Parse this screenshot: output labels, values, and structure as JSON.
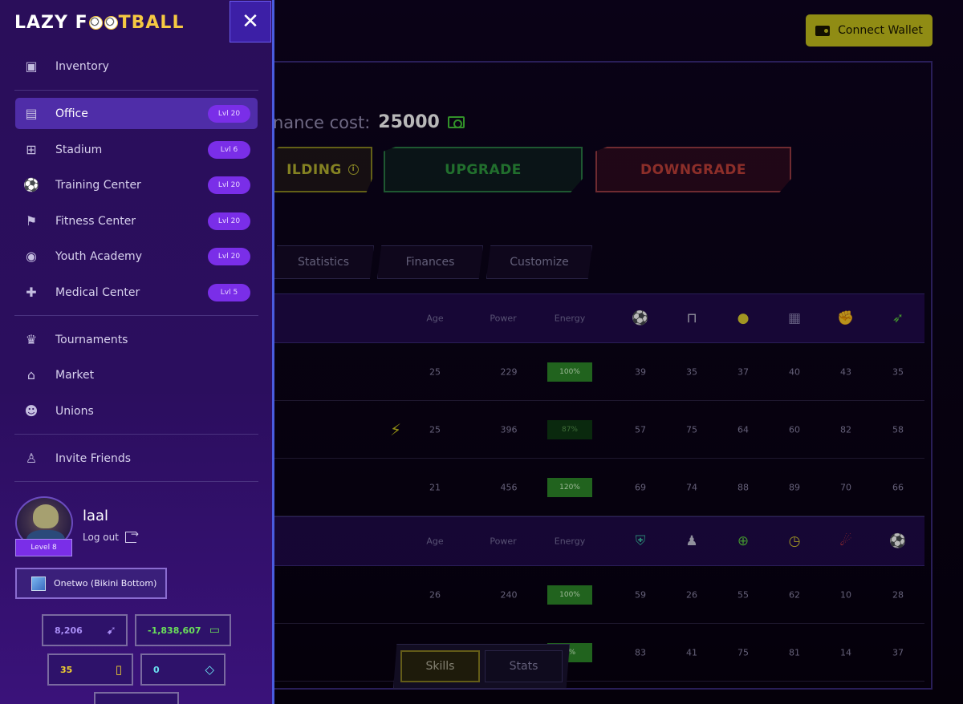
{
  "header": {
    "connect_wallet_label": "Connect Wallet"
  },
  "building": {
    "maintenance_label": "nance cost:",
    "maintenance_value": "25000",
    "actions": {
      "building_label": "ILDING",
      "upgrade_label": "UPGRADE",
      "downgrade_label": "DOWNGRADE"
    }
  },
  "tabs": [
    "Statistics",
    "Finances",
    "Customize"
  ],
  "table": {
    "headers": {
      "age": "Age",
      "power": "Power",
      "energy": "Energy"
    },
    "section1_rows": [
      {
        "age": "25",
        "power": "229",
        "energy": "100%",
        "stats": [
          "39",
          "35",
          "37",
          "40",
          "43",
          "35"
        ]
      },
      {
        "age": "25",
        "power": "396",
        "energy": "87%",
        "stats": [
          "57",
          "75",
          "64",
          "60",
          "82",
          "58"
        ]
      },
      {
        "age": "21",
        "power": "456",
        "energy": "120%",
        "stats": [
          "69",
          "74",
          "88",
          "89",
          "70",
          "66"
        ]
      }
    ],
    "section2_rows": [
      {
        "age": "26",
        "power": "240",
        "energy": "100%",
        "stats": [
          "59",
          "26",
          "55",
          "62",
          "10",
          "28"
        ]
      },
      {
        "age": "",
        "power": "",
        "energy": "0%",
        "stats": [
          "83",
          "41",
          "75",
          "81",
          "14",
          "37"
        ]
      }
    ]
  },
  "bottom_toggle": {
    "skills_label": "Skills",
    "stats_label": "Stats"
  },
  "sidebar": {
    "logo": {
      "part1": "LAZY F",
      "part2": "TBALL"
    },
    "nav": [
      {
        "label": "Inventory",
        "icon": "backpack-icon"
      },
      {
        "label": "Office",
        "icon": "document-icon",
        "level": "Lvl 20",
        "active": true
      },
      {
        "label": "Stadium",
        "icon": "stadium-icon",
        "level": "Lvl 6"
      },
      {
        "label": "Training Center",
        "icon": "training-icon",
        "level": "Lvl 20"
      },
      {
        "label": "Fitness Center",
        "icon": "treadmill-icon",
        "level": "Lvl 20"
      },
      {
        "label": "Youth Academy",
        "icon": "academy-icon",
        "level": "Lvl 20"
      },
      {
        "label": "Medical Center",
        "icon": "bandage-icon",
        "level": "Lvl 5"
      },
      {
        "label": "Tournaments",
        "icon": "crown-icon"
      },
      {
        "label": "Market",
        "icon": "market-icon"
      },
      {
        "label": "Unions",
        "icon": "group-icon"
      },
      {
        "label": "Invite Friends",
        "icon": "add-user-icon"
      }
    ],
    "profile": {
      "username": "laal",
      "logout_label": "Log out",
      "level_label": "Level 8"
    },
    "club_label": "Onetwo (Bikini Bottom)",
    "stats": {
      "tokens": "8,206",
      "cash": "-1,838,607",
      "cards": "35",
      "diamonds": "0"
    }
  },
  "colors": {
    "accent": "#7a2ee8",
    "sidebar_bg": "#2a0e5a",
    "wallet_btn": "#c8c31c"
  }
}
